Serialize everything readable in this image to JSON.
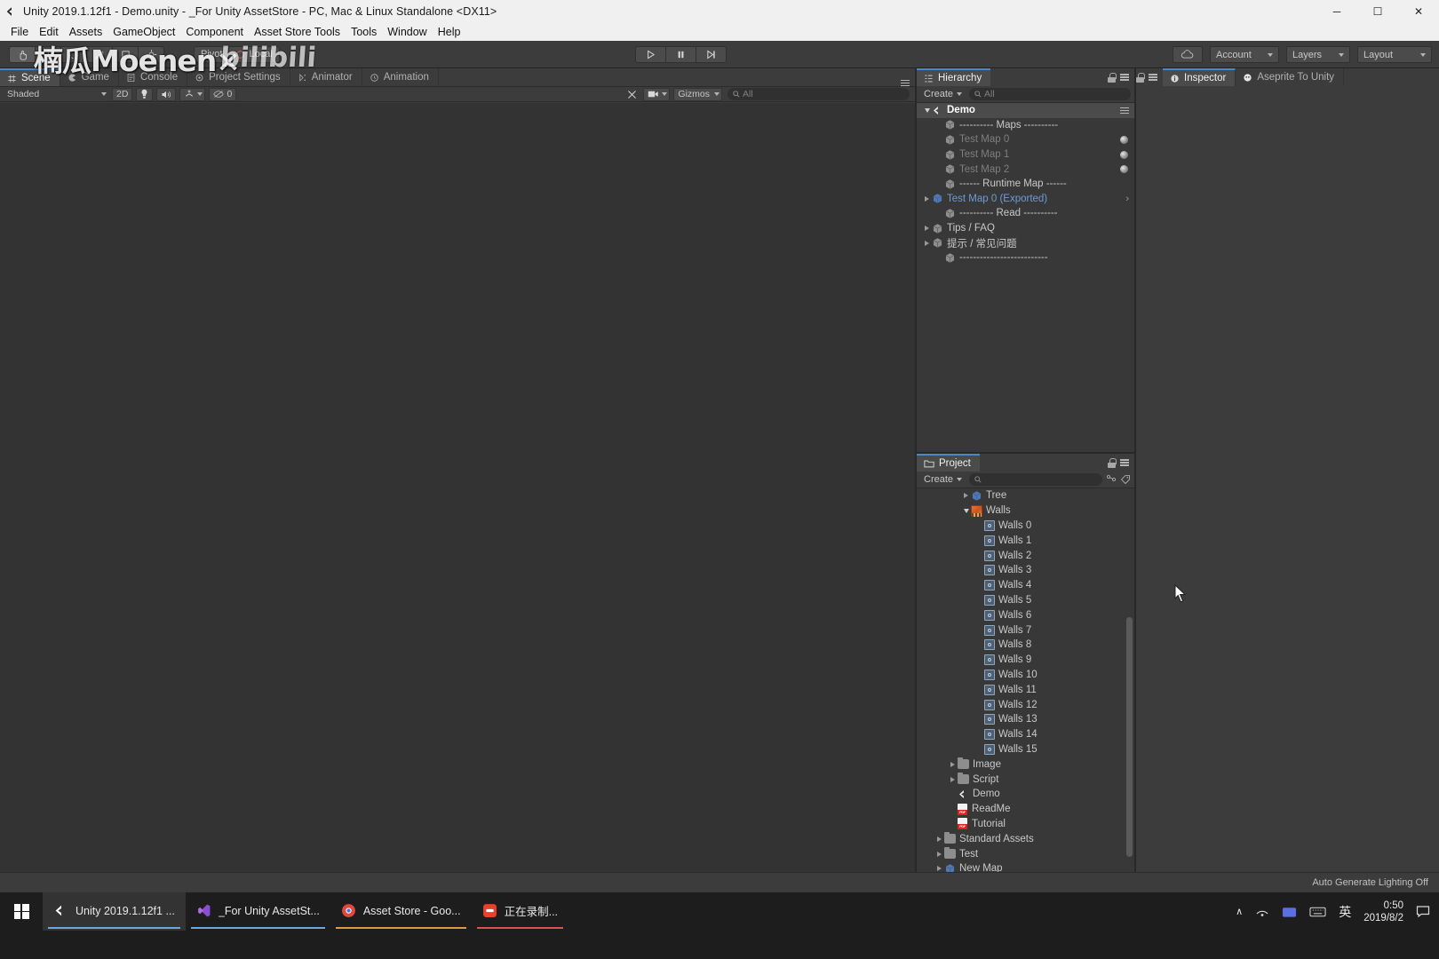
{
  "window": {
    "title": "Unity 2019.1.12f1 - Demo.unity - _For Unity AssetStore - PC, Mac & Linux Standalone <DX11>",
    "minimize": "─",
    "maximize": "☐",
    "close": "✕"
  },
  "menubar": {
    "items": [
      "File",
      "Edit",
      "Assets",
      "GameObject",
      "Component",
      "Asset Store Tools",
      "Tools",
      "Window",
      "Help"
    ]
  },
  "watermark": {
    "cn": "楠瓜Moenen×",
    "bili": "bilibili"
  },
  "toolbar": {
    "transform_tools": [
      "hand-tool",
      "move-tool",
      "rotate-tool",
      "scale-tool",
      "rect-tool",
      "transform-tool"
    ],
    "pivot_mode": "Pivot",
    "pivot_rotation": "Local",
    "play": "▶",
    "pause": "❙❙",
    "step": "▶❙",
    "cloud": "cloud-icon",
    "account": "Account",
    "layers": "Layers",
    "layout": "Layout"
  },
  "scene": {
    "tabs": [
      {
        "label": "Scene",
        "icon": "scene-grid-icon",
        "active": true
      },
      {
        "label": "Game",
        "icon": "game-pacman-icon",
        "active": false
      },
      {
        "label": "Console",
        "icon": "console-icon",
        "active": false
      },
      {
        "label": "Project Settings",
        "icon": "gear-icon",
        "active": false
      },
      {
        "label": "Animator",
        "icon": "animator-icon",
        "active": false
      },
      {
        "label": "Animation",
        "icon": "animation-clock-icon",
        "active": false
      }
    ],
    "toolbar": {
      "draw_mode": "Shaded",
      "dimension": "2D",
      "lighting": "light-bulb-icon",
      "audio": "speaker-icon",
      "fx": "fx-icon",
      "hidden_count": "0",
      "scene_tools": "tools-icon",
      "camera": "camera-icon",
      "gizmos": "Gizmos",
      "search_placeholder": "All"
    }
  },
  "hierarchy": {
    "title": "Hierarchy",
    "create": "Create",
    "search_placeholder": "All",
    "rows": [
      {
        "label": "Demo",
        "indent": 0,
        "style": "root",
        "arrow": "open",
        "icon": "unity-scene-icon",
        "menu": true
      },
      {
        "label": "---------- Maps ----------",
        "indent": 1,
        "style": "normal",
        "arrow": "none",
        "icon": "cube-icon"
      },
      {
        "label": "Test Map 0",
        "indent": 1,
        "style": "dim",
        "arrow": "none",
        "icon": "cube-icon",
        "eye": true
      },
      {
        "label": "Test Map 1",
        "indent": 1,
        "style": "dim",
        "arrow": "none",
        "icon": "cube-icon",
        "eye": true
      },
      {
        "label": "Test Map 2",
        "indent": 1,
        "style": "dim",
        "arrow": "none",
        "icon": "cube-icon",
        "eye": true
      },
      {
        "label": "------ Runtime Map ------",
        "indent": 1,
        "style": "normal",
        "arrow": "none",
        "icon": "cube-icon"
      },
      {
        "label": "Test Map 0 (Exported)",
        "indent": 0,
        "style": "prefab",
        "arrow": "closed",
        "icon": "prefab-cube-icon",
        "chevron": true
      },
      {
        "label": "---------- Read ----------",
        "indent": 1,
        "style": "normal",
        "arrow": "none",
        "icon": "cube-icon"
      },
      {
        "label": "Tips / FAQ",
        "indent": 0,
        "style": "normal",
        "arrow": "closed",
        "icon": "cube-icon"
      },
      {
        "label": "提示 / 常见问题",
        "indent": 0,
        "style": "normal",
        "arrow": "closed",
        "icon": "cube-icon"
      },
      {
        "label": "--------------------------",
        "indent": 1,
        "style": "normal",
        "arrow": "none",
        "icon": "cube-icon"
      }
    ]
  },
  "project": {
    "title": "Project",
    "create": "Create",
    "search_placeholder": "",
    "rows": [
      {
        "label": "Tree",
        "indent": 2,
        "icon": "prefab-cube-icon",
        "arrow": "closed"
      },
      {
        "label": "Walls",
        "indent": 2,
        "icon": "texture-icon",
        "arrow": "open"
      },
      {
        "label": "Walls 0",
        "indent": 3,
        "icon": "sprite-icon",
        "arrow": "none"
      },
      {
        "label": "Walls 1",
        "indent": 3,
        "icon": "sprite-icon",
        "arrow": "none"
      },
      {
        "label": "Walls 2",
        "indent": 3,
        "icon": "sprite-icon",
        "arrow": "none"
      },
      {
        "label": "Walls 3",
        "indent": 3,
        "icon": "sprite-icon",
        "arrow": "none"
      },
      {
        "label": "Walls 4",
        "indent": 3,
        "icon": "sprite-icon",
        "arrow": "none"
      },
      {
        "label": "Walls 5",
        "indent": 3,
        "icon": "sprite-icon",
        "arrow": "none"
      },
      {
        "label": "Walls 6",
        "indent": 3,
        "icon": "sprite-icon",
        "arrow": "none"
      },
      {
        "label": "Walls 7",
        "indent": 3,
        "icon": "sprite-icon",
        "arrow": "none"
      },
      {
        "label": "Walls 8",
        "indent": 3,
        "icon": "sprite-icon",
        "arrow": "none"
      },
      {
        "label": "Walls 9",
        "indent": 3,
        "icon": "sprite-icon",
        "arrow": "none"
      },
      {
        "label": "Walls 10",
        "indent": 3,
        "icon": "sprite-icon",
        "arrow": "none"
      },
      {
        "label": "Walls 11",
        "indent": 3,
        "icon": "sprite-icon",
        "arrow": "none"
      },
      {
        "label": "Walls 12",
        "indent": 3,
        "icon": "sprite-icon",
        "arrow": "none"
      },
      {
        "label": "Walls 13",
        "indent": 3,
        "icon": "sprite-icon",
        "arrow": "none"
      },
      {
        "label": "Walls 14",
        "indent": 3,
        "icon": "sprite-icon",
        "arrow": "none"
      },
      {
        "label": "Walls 15",
        "indent": 3,
        "icon": "sprite-icon",
        "arrow": "none"
      },
      {
        "label": "Image",
        "indent": 1,
        "icon": "folder-icon",
        "arrow": "closed"
      },
      {
        "label": "Script",
        "indent": 1,
        "icon": "folder-icon",
        "arrow": "closed"
      },
      {
        "label": "Demo",
        "indent": 1,
        "icon": "unity-scene-icon",
        "arrow": "none"
      },
      {
        "label": "ReadMe",
        "indent": 1,
        "icon": "pdf-icon",
        "arrow": "none"
      },
      {
        "label": "Tutorial",
        "indent": 1,
        "icon": "pdf-icon",
        "arrow": "none"
      },
      {
        "label": "Standard Assets",
        "indent": 0,
        "icon": "folder-icon",
        "arrow": "closed"
      },
      {
        "label": "Test",
        "indent": 0,
        "icon": "folder-icon",
        "arrow": "closed"
      },
      {
        "label": "New Map",
        "indent": 0,
        "icon": "prefab-cube-icon",
        "arrow": "closed"
      }
    ]
  },
  "inspector": {
    "tabs": [
      {
        "label": "Inspector",
        "icon": "info-icon",
        "active": true
      },
      {
        "label": "Aseprite To Unity",
        "icon": "aseprite-icon",
        "active": false
      }
    ]
  },
  "statusbar": {
    "text": "Auto Generate Lighting Off"
  },
  "taskbar": {
    "start": "windows-logo",
    "items": [
      {
        "label": "Unity 2019.1.12f1 ...",
        "icon": "unity-icon",
        "accent": "blue",
        "active": true
      },
      {
        "label": "_For Unity AssetSt...",
        "icon": "vscode-icon",
        "accent": "blue",
        "active": false
      },
      {
        "label": "Asset Store - Goo...",
        "icon": "chrome-icon",
        "accent": "orange",
        "active": false
      },
      {
        "label": "正在录制...",
        "icon": "recorder-icon",
        "accent": "red",
        "active": false
      }
    ],
    "tray": {
      "chevron": "∧",
      "network": "network-icon",
      "onedrive": "onedrive-icon",
      "keyboard": "keyboard-icon",
      "ime": "英",
      "time": "0:50",
      "date": "2019/8/2",
      "notifications": "notification-icon"
    }
  }
}
